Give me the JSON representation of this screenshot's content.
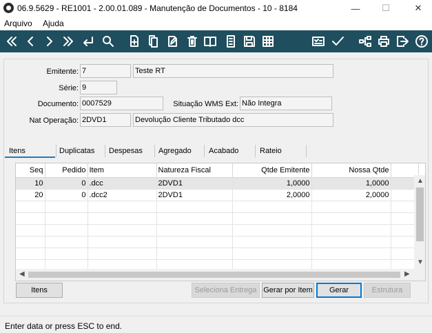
{
  "window": {
    "title": "06.9.5629 - RE1001 - 2.00.01.089 - Manutenção de Documentos - 10 - 8184",
    "minimize": "—",
    "maximize": "☐",
    "close": "✕"
  },
  "menu": [
    "Arquivo",
    "Ajuda"
  ],
  "toolbar": {
    "icons": [
      "first-icon",
      "previous-icon",
      "next-icon",
      "last-icon",
      "goto-icon",
      "search-icon",
      "new-icon",
      "copy-icon",
      "edit-icon",
      "delete-icon",
      "book-icon",
      "list-icon",
      "save-icon",
      "grid-icon",
      "checklist-icon",
      "confirm-icon",
      "tree-icon",
      "print-icon",
      "exit-icon",
      "help-icon"
    ]
  },
  "form": {
    "emitente_label": "Emitente:",
    "emitente_code": "7",
    "emitente_name": "Teste RT",
    "serie_label": "Série:",
    "serie": "9",
    "documento_label": "Documento:",
    "documento": "0007529",
    "situacao_label": "Situação WMS Ext:",
    "situacao": "Não Integra",
    "natop_label": "Nat Operação:",
    "natop_code": "2DVD1",
    "natop_desc": "Devolução Cliente Tributado dcc"
  },
  "tabs": [
    "Itens",
    "Duplicatas",
    "Despesas",
    "Agregado",
    "Acabado",
    "Rateio"
  ],
  "grid": {
    "columns": [
      "Seq",
      "Pedido",
      "Item",
      "Natureza Fiscal",
      "Qtde Emitente",
      "Nossa Qtde"
    ],
    "rows": [
      [
        "10",
        "0",
        ".dcc",
        "2DVD1",
        "1,0000",
        "1,0000"
      ],
      [
        "20",
        "0",
        ".dcc2",
        "2DVD1",
        "2,0000",
        "2,0000"
      ]
    ]
  },
  "buttons": {
    "itens": "Itens",
    "seleciona_entrega": "Seleciona Entrega",
    "gerar_por_item": "Gerar por Item",
    "gerar": "Gerar",
    "estrutura": "Estrutura"
  },
  "status": "Enter data or press ESC to end."
}
